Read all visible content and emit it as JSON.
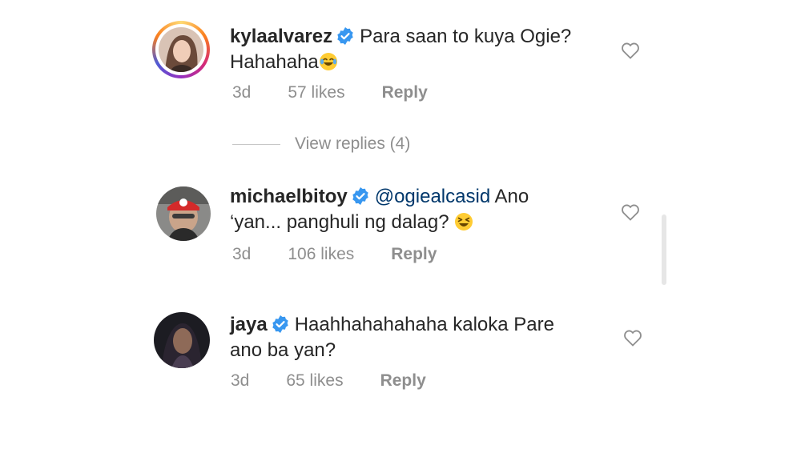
{
  "comments": [
    {
      "username": "kylaalvarez",
      "text_line1": "Para saan to kuya Ogie?",
      "text_line2": "Hahahaha",
      "emoji": "😂",
      "age": "3d",
      "likes": "57 likes",
      "reply": "Reply"
    },
    {
      "username": "michaelbitoy",
      "mention": "@ogiealcasid",
      "text_line1": "Ano",
      "text_line2": "‘yan... panghuli ng dalag?",
      "emoji": "😆",
      "age": "3d",
      "likes": "106 likes",
      "reply": "Reply"
    },
    {
      "username": "jaya",
      "text_line1": "Haahhahahahaha kaloka Pare",
      "text_line2": "ano ba yan?",
      "age": "3d",
      "likes": "65 likes",
      "reply": "Reply"
    }
  ],
  "view_replies": "View replies (4)",
  "colors": {
    "verified": "#3897f0",
    "mention": "#00376b",
    "meta": "#8e8e8e"
  },
  "icons": [
    "verified-badge-icon",
    "heart-icon",
    "tears-of-joy-emoji",
    "laughing-emoji"
  ]
}
